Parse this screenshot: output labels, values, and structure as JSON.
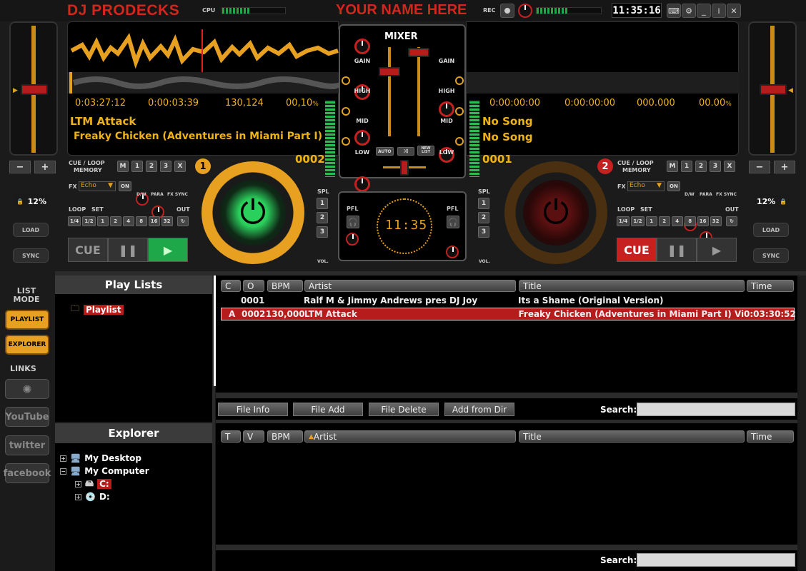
{
  "app": {
    "logo": "DJ PRODECKS",
    "custom_name": "YOUR NAME HERE",
    "clock": "11:35:16",
    "cpu_label": "CPU",
    "cpu_level": 0.45,
    "rec_label": "REC",
    "rec_level": 0.5
  },
  "deck1": {
    "number": "1",
    "pitch": "12%",
    "elapsed": "0:03:27:12",
    "remain": "0:00:03:39",
    "bpm": "130,124",
    "pitch_pct": "00,10",
    "pct_sign": "%",
    "artist": "LTM Attack",
    "title": "Freaky Chicken (Adventures in Miami Part I) V",
    "track_no": "0002",
    "cue_loop_label": "CUE / LOOP",
    "memory_label": "MEMORY",
    "memory_buttons": [
      "M",
      "1",
      "2",
      "3",
      "X"
    ],
    "fx_label": "FX",
    "fx_value": "Echo",
    "fx_on": "ON",
    "dw": "D/W",
    "para": "PARA",
    "fxsync": "FX SYNC",
    "loop_label": "LOOP",
    "set_label": "SET",
    "out_label": "OUT",
    "loop_values": [
      "1/4",
      "1/2",
      "1",
      "2",
      "4",
      "8",
      "16",
      "32"
    ],
    "cue": "CUE",
    "load": "LOAD",
    "sync": "SYNC"
  },
  "deck2": {
    "number": "2",
    "pitch": "12%",
    "elapsed": "0:00:00:00",
    "remain": "0:00:00:00",
    "bpm": "000.000",
    "pitch_pct": "00.00",
    "pct_sign": "%",
    "artist": "No Song",
    "title": "No Song",
    "track_no": "0001",
    "cue_loop_label": "CUE / LOOP",
    "memory_label": "MEMORY",
    "memory_buttons": [
      "M",
      "1",
      "2",
      "3",
      "X"
    ],
    "fx_label": "FX",
    "fx_value": "Echo",
    "fx_on": "ON",
    "dw": "D/W",
    "para": "PARA",
    "fxsync": "FX SYNC",
    "loop_label": "LOOP",
    "set_label": "SET",
    "out_label": "OUT",
    "loop_values": [
      "1/4",
      "1/2",
      "1",
      "2",
      "4",
      "8",
      "16",
      "32"
    ],
    "cue": "CUE",
    "load": "LOAD",
    "sync": "SYNC"
  },
  "mixer": {
    "title": "MIXER",
    "gain": "GAIN",
    "high": "HIGH",
    "mid": "MID",
    "low": "LOW",
    "auto": "AUTO",
    "new_list": "NEW LIST",
    "spl": "SPL",
    "pfl": "PFL",
    "vol": "VOL.",
    "spl_buttons": [
      "1",
      "2",
      "3"
    ],
    "center_clock": "11:35"
  },
  "nav": {
    "list_mode": "LIST MODE",
    "playlist": "PLAYLIST",
    "explorer": "EXPLORER",
    "links": "LINKS",
    "youtube": "YouTube",
    "twitter": "twitter",
    "facebook": "facebook"
  },
  "playlists": {
    "header": "Play Lists",
    "items": [
      "Playlist"
    ]
  },
  "explorer": {
    "header": "Explorer",
    "items": [
      "My Desktop",
      "My Computer",
      "C:",
      "D:"
    ]
  },
  "table1": {
    "columns": [
      "C",
      "O",
      "BPM",
      "Artist",
      "Title",
      "Time"
    ],
    "rows": [
      {
        "c": "",
        "o": "0001",
        "bpm": "",
        "artist": "Ralf M & Jimmy Andrews pres DJ Joy",
        "title": "Its a Shame (Original Version)",
        "time": ""
      },
      {
        "c": "A",
        "o": "0002",
        "bpm": "130,000",
        "artist": "LTM Attack",
        "title": "Freaky Chicken (Adventures in Miami Part I) Video E",
        "time": "0:03:30:52"
      }
    ]
  },
  "actions": {
    "file_info": "File Info",
    "file_add": "File Add",
    "file_delete": "File Delete",
    "add_from_dir": "Add from Dir",
    "search": "Search:"
  },
  "table2": {
    "columns": [
      "T",
      "V",
      "BPM",
      "Artist",
      "Title",
      "Time"
    ],
    "search": "Search:"
  }
}
